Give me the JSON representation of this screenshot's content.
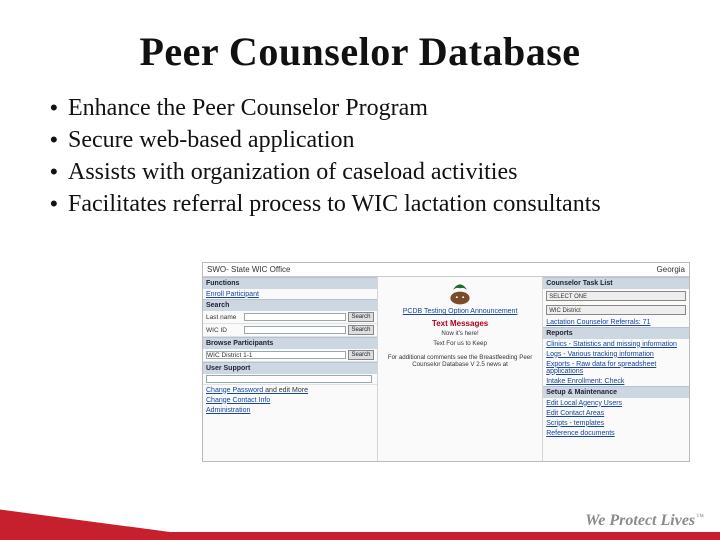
{
  "title": "Peer Counselor Database",
  "bullets": [
    "Enhance the Peer Counselor Program",
    "Secure web-based application",
    "Assists with organization of caseload activities",
    "Facilitates referral process to WIC lactation consultants"
  ],
  "tagline": "We Protect Lives",
  "screenshot": {
    "app_title": "SWO- State WIC Office",
    "state": "Georgia",
    "left": {
      "panel_title": "Functions",
      "enroll": "Enroll Participant",
      "search_header": "Search",
      "search_btn": "Search",
      "lbl_lastname": "Last name",
      "lbl_wicid": "WIC ID",
      "browse": "Browse Participants",
      "sort_value": "WIC District 1-1",
      "user_support": "User Support",
      "links": {
        "change_password": "Change Password",
        "change_contact": "Change Contact Info",
        "admin": "Administration"
      },
      "misc": "and edit More"
    },
    "center": {
      "announce_title": "PCDB Testing Option Announcement",
      "text_messages": "Text Messages",
      "line1": "Now it's here!",
      "line2": "Text For us to Keep",
      "line3": "For additional comments see the Breastfeeding Peer Counselor Database V 2.5 news at"
    },
    "right": {
      "panel_title": "Counselor Task List",
      "select_one": "SELECT ONE",
      "wic_district": "WIC District",
      "lactation_link": "Lactation Counselor Referrals: 71",
      "reports_header": "Reports",
      "reports": {
        "clinics": "Clinics -  Statistics and missing information",
        "logs": "Logs -  Various tracking information",
        "exports": "Exports -  Raw data for spreadsheet applications",
        "intake": "Intake Enrollment: Check"
      },
      "maint_header": "Setup & Maintenance",
      "maint": {
        "edit_local": "Edit Local Agency Users",
        "edit_contact": "Edit Contact Areas",
        "scripts": "Scripts - templates",
        "ref": "Reference documents"
      }
    }
  }
}
